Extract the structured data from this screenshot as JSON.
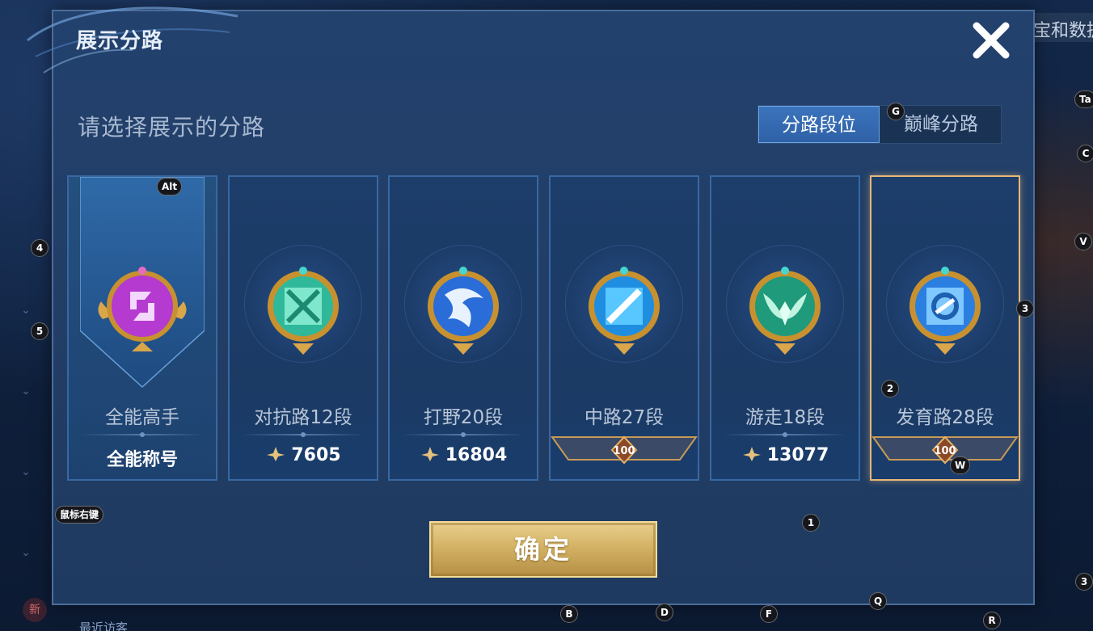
{
  "background": {
    "right_text": "宝和数据",
    "bottom_text": "最近访客",
    "new_badge": "新"
  },
  "dialog": {
    "title": "展示分路",
    "subtitle": "请选择展示的分路",
    "close_icon": "close-icon"
  },
  "tabs": [
    {
      "label": "分路段位",
      "active": true
    },
    {
      "label": "巅峰分路",
      "active": false
    }
  ],
  "cards": [
    {
      "rank": "全能高手",
      "stat": "全能称号",
      "type": "allround",
      "emblem_color": "#b43ad0"
    },
    {
      "rank": "对抗路12段",
      "stat": "7605",
      "type": "points",
      "emblem_color": "#2fb89a"
    },
    {
      "rank": "打野20段",
      "stat": "16804",
      "type": "points",
      "emblem_color": "#2a6dd8"
    },
    {
      "rank": "中路27段",
      "stat": "100",
      "type": "tier",
      "emblem_color": "#1f8ee0"
    },
    {
      "rank": "游走18段",
      "stat": "13077",
      "type": "points",
      "emblem_color": "#1f9a7a"
    },
    {
      "rank": "发育路28段",
      "stat": "100",
      "type": "tier",
      "emblem_color": "#2b7fe0",
      "selected": true
    }
  ],
  "confirm_label": "确定",
  "hints": {
    "alt": "Alt",
    "g": "G",
    "ta": "Ta",
    "c": "C",
    "v": "V",
    "three_a": "3",
    "three_b": "3",
    "four": "4",
    "five": "5",
    "two": "2",
    "w": "W",
    "one": "1",
    "right_click": "鼠标右键",
    "q": "Q",
    "b": "B",
    "d": "D",
    "f": "F",
    "r": "R"
  },
  "colors": {
    "accent": "#3b74bd",
    "gold": "#d4b265",
    "selected_border": "#e8b877"
  }
}
